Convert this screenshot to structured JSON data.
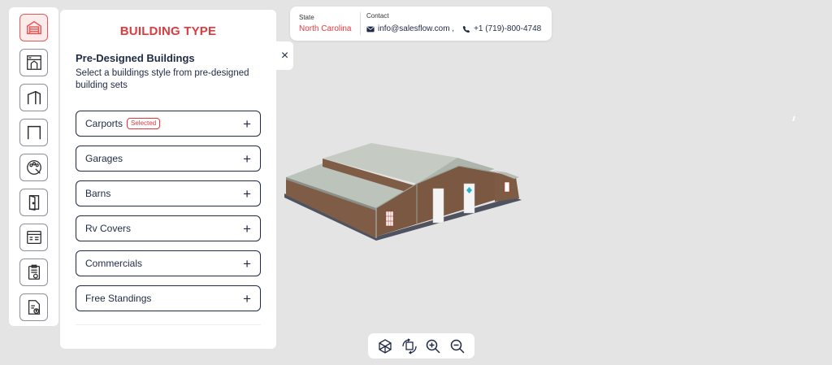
{
  "colors": {
    "accent": "#e0393e",
    "text_dark": "#1f2a44",
    "background": "#e4e4e4",
    "panel": "#ffffff"
  },
  "rail": {
    "items": [
      {
        "icon": "garage-icon",
        "active": true
      },
      {
        "icon": "building-plan-icon",
        "active": false
      },
      {
        "icon": "roof-frame-icon",
        "active": false
      },
      {
        "icon": "frame-outline-icon",
        "active": false
      },
      {
        "icon": "color-palette-icon",
        "active": false
      },
      {
        "icon": "door-icon",
        "active": false
      },
      {
        "icon": "options-panel-icon",
        "active": false
      },
      {
        "icon": "clipboard-check-icon",
        "active": false
      },
      {
        "icon": "document-upload-icon",
        "active": false
      }
    ]
  },
  "panel": {
    "title": "BUILDING TYPE",
    "subtitle": "Pre-Designed Buildings",
    "description": "Select a buildings style from pre-designed building sets",
    "items": [
      {
        "label": "Carports",
        "badge": "Selected"
      },
      {
        "label": "Garages",
        "badge": ""
      },
      {
        "label": "Barns",
        "badge": ""
      },
      {
        "label": "Rv Covers",
        "badge": ""
      },
      {
        "label": "Commercials",
        "badge": ""
      },
      {
        "label": "Free Standings",
        "badge": ""
      }
    ],
    "expand_symbol": "+",
    "close_symbol": "×"
  },
  "header": {
    "state_label": "State",
    "state_value": "North Carolina",
    "contact_label": "Contact",
    "email": "info@salesflow.com ,",
    "phone": "+1 (719)-800-4748"
  },
  "toolbar": {
    "buttons": [
      "cube-view-icon",
      "rotate-view-icon",
      "zoom-in-icon",
      "zoom-out-icon"
    ]
  }
}
